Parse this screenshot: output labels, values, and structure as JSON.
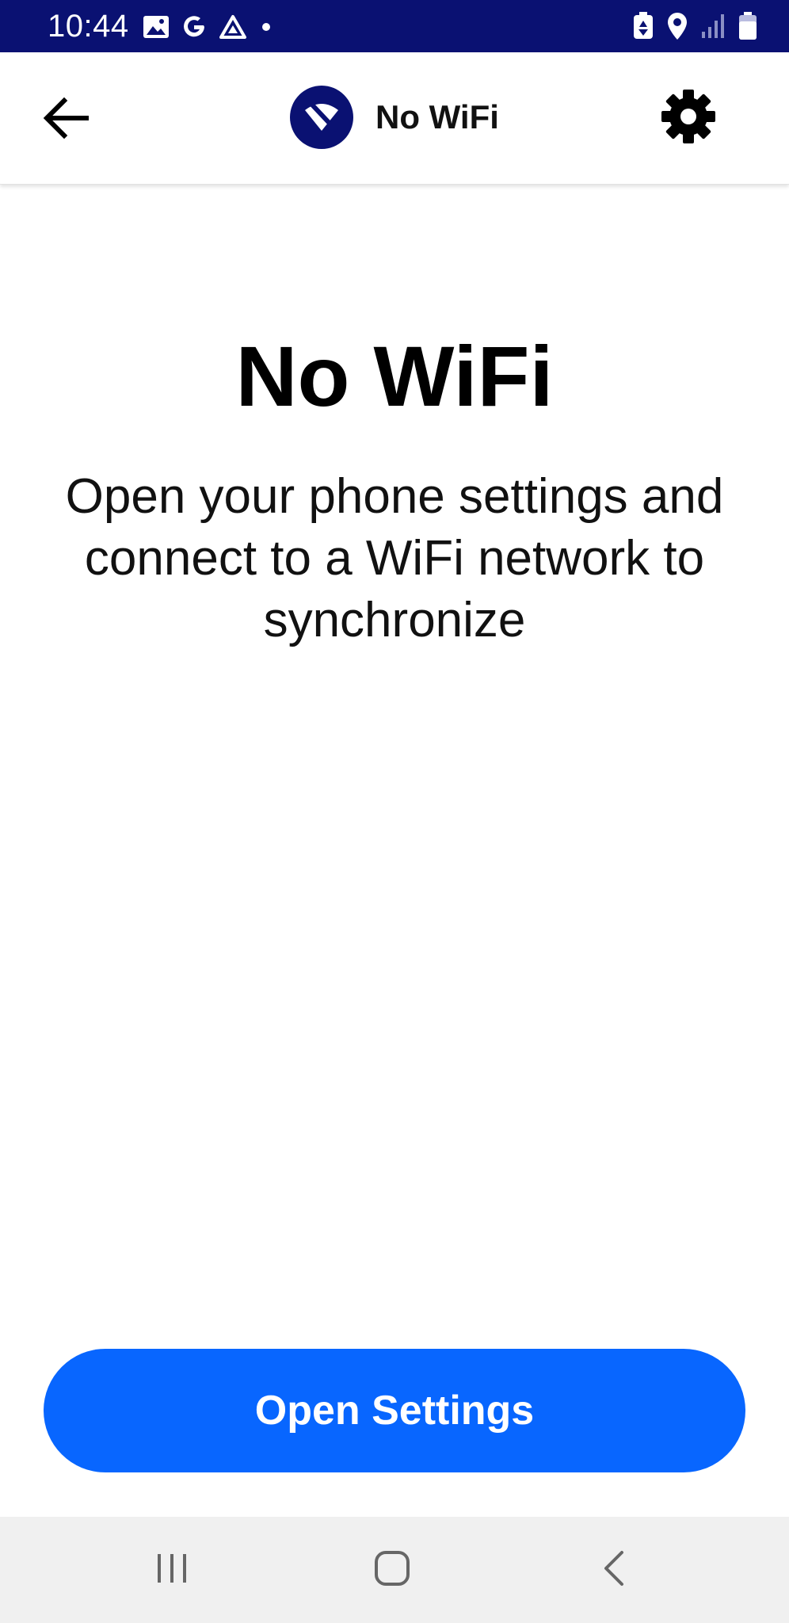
{
  "status_bar": {
    "time": "10:44",
    "background": "#0a1172",
    "left_icons": [
      "gallery-icon",
      "google-icon",
      "drive-icon",
      "dot-icon"
    ],
    "right_icons": [
      "battery-saver-icon",
      "location-icon",
      "signal-icon",
      "battery-icon"
    ]
  },
  "app_bar": {
    "back_icon": "arrow-left-icon",
    "title_icon": "wifi-off-icon",
    "title": "No WiFi",
    "settings_icon": "gear-icon"
  },
  "main": {
    "heading": "No WiFi",
    "message": "Open your phone settings and connect to a WiFi network to synchronize"
  },
  "actions": {
    "open_settings_label": "Open Settings",
    "button_color": "#0866ff"
  },
  "nav_bar": {
    "icons": [
      "recents-icon",
      "home-icon",
      "back-icon"
    ]
  }
}
